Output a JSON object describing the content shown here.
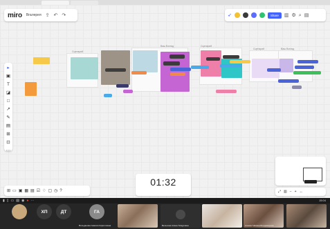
{
  "app": {
    "logo": "miro",
    "board_name": "Вгалерея"
  },
  "top_right": {
    "share_label": "Share"
  },
  "frame_labels": [
    "Сценарий",
    "Ваш Взгляд",
    "Сценарий",
    "Сценарий",
    "Ваш Взгляд"
  ],
  "timer": {
    "value": "01:32"
  },
  "status": {
    "clock": "15:04"
  },
  "participants": [
    {
      "initials": "ХП",
      "color": "#3a3a3a"
    },
    {
      "initials": "ДТ",
      "color": "#3a3a3a"
    },
    {
      "initials": "ГА",
      "color": "#8a8a8a"
    }
  ],
  "participant_names": [
    "Вольданова Амалия Кирилловна",
    "Вельтина Алина Тимуровна",
    "Агаева Гайкана Владимирова"
  ],
  "icons": {
    "cursor": "▸",
    "frame": "▣",
    "text": "T",
    "sticky": "◪",
    "shape": "□",
    "pen": "✎",
    "connector": "↗",
    "comment": "▤",
    "more": "⋯"
  }
}
